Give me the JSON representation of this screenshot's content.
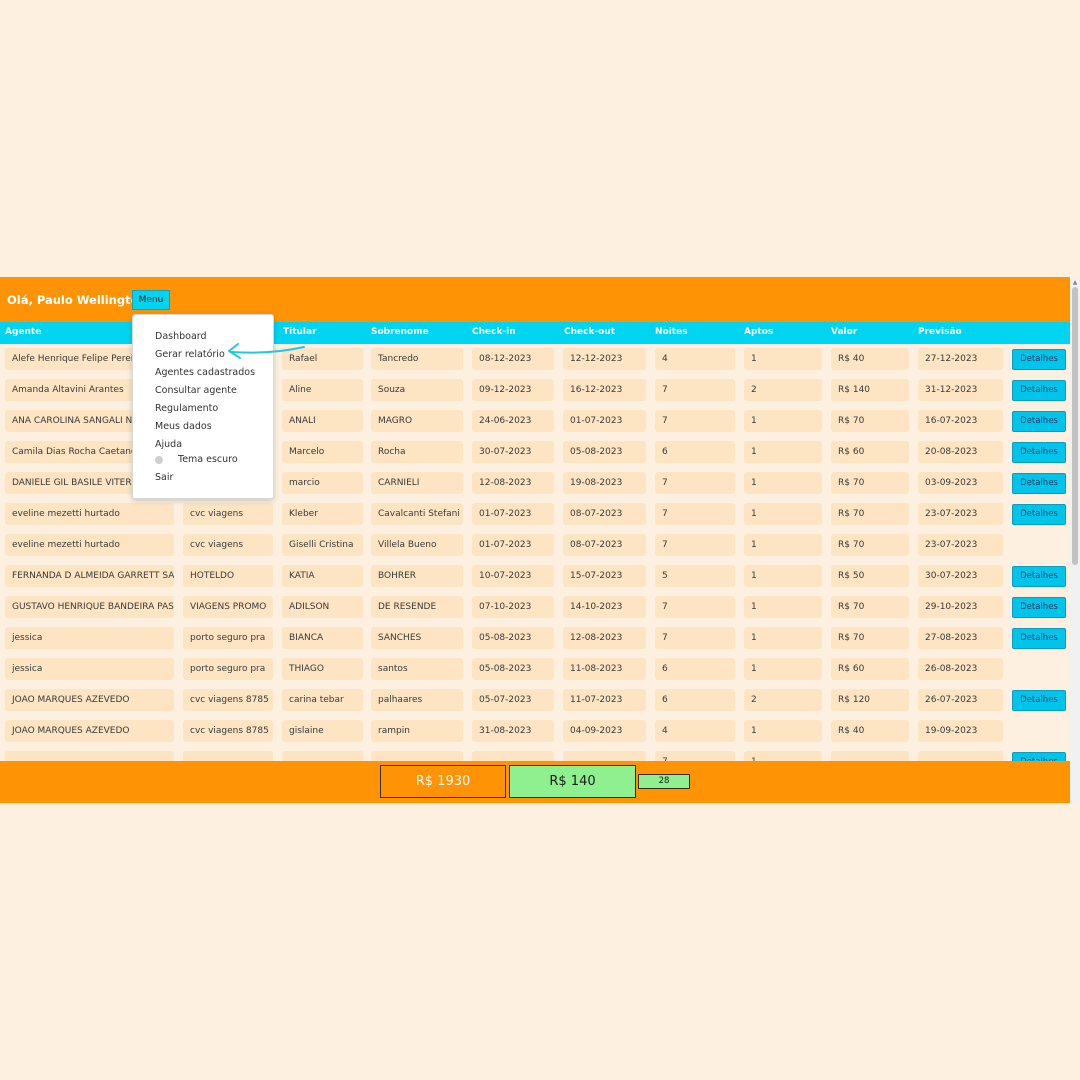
{
  "header": {
    "greeting": "Olá, Paulo Wellington",
    "menu_label": "Menu"
  },
  "columns": [
    "Agente",
    "Titular",
    "Sobrenome",
    "Check-in",
    "Check-out",
    "Noites",
    "Aptos",
    "Valor",
    "Previsão"
  ],
  "details_label": "Detalhes",
  "rows": [
    {
      "agente": "Alefe Henrique Felipe Pereira",
      "agencia": "",
      "titular": "Rafael",
      "sobrenome": "Tancredo",
      "checkin": "08-12-2023",
      "checkout": "12-12-2023",
      "noites": "4",
      "aptos": "1",
      "valor": "R$ 40",
      "previsao": "27-12-2023",
      "detalhes": true
    },
    {
      "agente": "Amanda Altavini Arantes",
      "agencia": "",
      "titular": "Aline",
      "sobrenome": "Souza",
      "checkin": "09-12-2023",
      "checkout": "16-12-2023",
      "noites": "7",
      "aptos": "2",
      "valor": "R$ 140",
      "previsao": "31-12-2023",
      "detalhes": true
    },
    {
      "agente": "ANA CAROLINA SANGALI NAI",
      "agencia": "",
      "titular": "ANALI",
      "sobrenome": "MAGRO",
      "checkin": "24-06-2023",
      "checkout": "01-07-2023",
      "noites": "7",
      "aptos": "1",
      "valor": "R$ 70",
      "previsao": "16-07-2023",
      "detalhes": true
    },
    {
      "agente": "Camila Dias Rocha Caetano",
      "agencia": "",
      "titular": "Marcelo",
      "sobrenome": "Rocha",
      "checkin": "30-07-2023",
      "checkout": "05-08-2023",
      "noites": "6",
      "aptos": "1",
      "valor": "R$ 60",
      "previsao": "20-08-2023",
      "detalhes": true
    },
    {
      "agente": "DANIELE GIL BASILE VITERI",
      "agencia": "",
      "titular": "marcio",
      "sobrenome": "CARNIELI",
      "checkin": "12-08-2023",
      "checkout": "19-08-2023",
      "noites": "7",
      "aptos": "1",
      "valor": "R$ 70",
      "previsao": "03-09-2023",
      "detalhes": true
    },
    {
      "agente": "eveline mezetti hurtado",
      "agencia": "cvc viagens",
      "titular": "Kleber",
      "sobrenome": "Cavalcanti Stefani",
      "checkin": "01-07-2023",
      "checkout": "08-07-2023",
      "noites": "7",
      "aptos": "1",
      "valor": "R$ 70",
      "previsao": "23-07-2023",
      "detalhes": true
    },
    {
      "agente": "eveline mezetti hurtado",
      "agencia": "cvc viagens",
      "titular": "Giselli Cristina",
      "sobrenome": "Villela Bueno",
      "checkin": "01-07-2023",
      "checkout": "08-07-2023",
      "noites": "7",
      "aptos": "1",
      "valor": "R$ 70",
      "previsao": "23-07-2023",
      "detalhes": false
    },
    {
      "agente": "FERNANDA D ALMEIDA GARRETT SAN",
      "agencia": "HOTELDO",
      "titular": "KATIA",
      "sobrenome": "BOHRER",
      "checkin": "10-07-2023",
      "checkout": "15-07-2023",
      "noites": "5",
      "aptos": "1",
      "valor": "R$ 50",
      "previsao": "30-07-2023",
      "detalhes": true
    },
    {
      "agente": "GUSTAVO HENRIQUE BANDEIRA PASS",
      "agencia": "VIAGENS PROMO",
      "titular": "ADILSON",
      "sobrenome": "DE RESENDE",
      "checkin": "07-10-2023",
      "checkout": "14-10-2023",
      "noites": "7",
      "aptos": "1",
      "valor": "R$ 70",
      "previsao": "29-10-2023",
      "detalhes": true
    },
    {
      "agente": "jessica",
      "agencia": "porto seguro pra",
      "titular": "BIANCA",
      "sobrenome": "SANCHES",
      "checkin": "05-08-2023",
      "checkout": "12-08-2023",
      "noites": "7",
      "aptos": "1",
      "valor": "R$ 70",
      "previsao": "27-08-2023",
      "detalhes": true
    },
    {
      "agente": "jessica",
      "agencia": "porto seguro pra",
      "titular": "THIAGO",
      "sobrenome": "santos",
      "checkin": "05-08-2023",
      "checkout": "11-08-2023",
      "noites": "6",
      "aptos": "1",
      "valor": "R$ 60",
      "previsao": "26-08-2023",
      "detalhes": false
    },
    {
      "agente": "JOAO MARQUES AZEVEDO",
      "agencia": "cvc viagens 8785",
      "titular": "carina tebar",
      "sobrenome": "palhaares",
      "checkin": "05-07-2023",
      "checkout": "11-07-2023",
      "noites": "6",
      "aptos": "2",
      "valor": "R$ 120",
      "previsao": "26-07-2023",
      "detalhes": true
    },
    {
      "agente": "JOAO MARQUES AZEVEDO",
      "agencia": "cvc viagens 8785",
      "titular": "gislaine",
      "sobrenome": "rampin",
      "checkin": "31-08-2023",
      "checkout": "04-09-2023",
      "noites": "4",
      "aptos": "1",
      "valor": "R$ 40",
      "previsao": "19-09-2023",
      "detalhes": false
    },
    {
      "agente": "",
      "agencia": "",
      "titular": "",
      "sobrenome": "",
      "checkin": "",
      "checkout": "",
      "noites": "7",
      "aptos": "1",
      "valor": "",
      "previsao": "",
      "detalhes": true
    }
  ],
  "footer": {
    "total": "R$ 1930",
    "max": "R$ 140",
    "count": "28"
  },
  "menu_items": {
    "dashboard": "Dashboard",
    "gerar_relatorio": "Gerar relatório",
    "agentes_cadastrados": "Agentes cadastrados",
    "consultar_agente": "Consultar agente",
    "regulamento": "Regulamento",
    "meus_dados": "Meus dados",
    "ajuda": "Ajuda",
    "tema_escuro": "Tema escuro",
    "sair": "Sair"
  },
  "colors": {
    "header_orange": "#ff9306",
    "column_header_cyan": "#00d4f0",
    "cell_bg": "#fde4c2",
    "details_button": "#00c4ea",
    "highlight_green": "#8ef08e",
    "annotation_arrow": "#1ec8e6"
  }
}
